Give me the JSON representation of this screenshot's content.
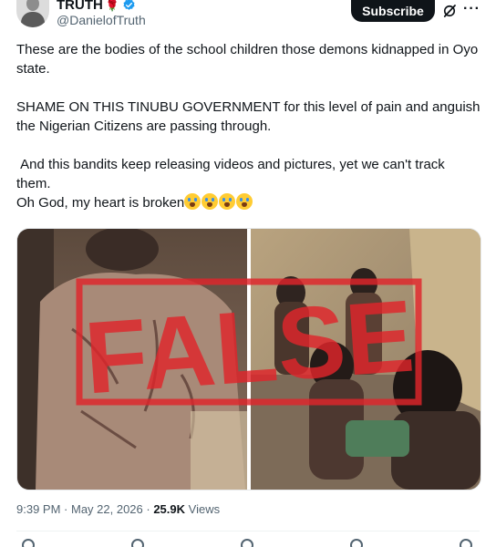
{
  "author": {
    "display_name": "TRUTH",
    "name_emoji": "🌹",
    "handle": "@DanielofTruth",
    "avatar_icon": "profile-avatar",
    "verified_icon": "verified-badge-icon"
  },
  "header": {
    "subscribe_label": "Subscribe",
    "grok_icon": "grok-icon",
    "more_icon": "more-options-icon",
    "more_glyph": "···"
  },
  "post": {
    "paragraphs": [
      "These are the bodies of the school children those demons kidnapped in Oyo state.",
      "SHAME ON THIS TINUBU GOVERNMENT for this level of pain and anguish the Nigerian Citizens are passing through.",
      " And this bandits keep releasing videos and pictures, yet we can't track them.",
      "Oh God, my heart is broken"
    ],
    "crying_emoji_count": 4,
    "media_stamp": "FALSE"
  },
  "meta": {
    "time": "9:39 PM",
    "separator": " · ",
    "date": "May 22, 2026",
    "views_count": "25.9K",
    "views_label": " Views"
  },
  "colors": {
    "accent": "#1d9bf0",
    "stamp_red": "#e0252b",
    "text": "#0f1419",
    "secondary": "#536471"
  },
  "actions": [
    "reply-icon",
    "repost-icon",
    "like-icon",
    "bookmark-icon",
    "share-icon"
  ]
}
